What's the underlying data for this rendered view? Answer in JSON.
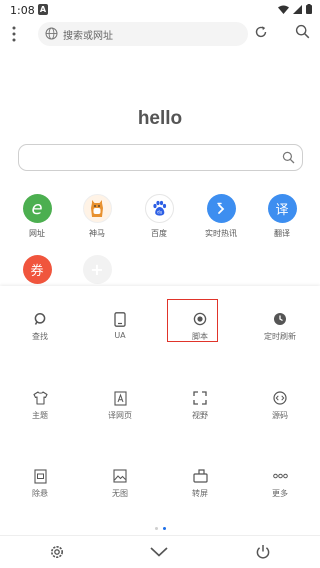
{
  "status_bar": {
    "time": "1:08",
    "indicator": "A"
  },
  "toolbar": {
    "address_placeholder": "搜索或网址"
  },
  "home": {
    "title": "hello"
  },
  "shortcuts": [
    {
      "label": "网址",
      "glyph": "e",
      "color": "#4caf50",
      "icon": "browser-e-icon"
    },
    {
      "label": "神马",
      "glyph": "",
      "color": "#fff3e6",
      "icon": "alpaca-icon"
    },
    {
      "label": "百度",
      "glyph": "",
      "color": "#ffffff",
      "icon": "baidu-paw-icon"
    },
    {
      "label": "实时热讯",
      "glyph": "",
      "color": "#3d8ef0",
      "icon": "hot-news-icon"
    },
    {
      "label": "翻译",
      "glyph": "译",
      "color": "#3d8ef0",
      "icon": "translate-icon"
    },
    {
      "label": "",
      "glyph": "券",
      "color": "#f0553d",
      "icon": "coupon-icon"
    },
    {
      "label": "",
      "glyph": "+",
      "color": "#f2f2f2",
      "icon": "add-icon"
    }
  ],
  "menu": {
    "items": [
      {
        "label": "查找",
        "icon": "find-icon"
      },
      {
        "label": "UA",
        "icon": "ua-icon"
      },
      {
        "label": "脚本",
        "icon": "script-icon"
      },
      {
        "label": "定时刷新",
        "icon": "timer-refresh-icon"
      },
      {
        "label": "主题",
        "icon": "theme-icon"
      },
      {
        "label": "译网页",
        "icon": "translate-page-icon"
      },
      {
        "label": "视野",
        "icon": "view-icon"
      },
      {
        "label": "源码",
        "icon": "source-code-icon"
      },
      {
        "label": "除悬",
        "icon": "remove-float-icon"
      },
      {
        "label": "无图",
        "icon": "no-image-icon"
      },
      {
        "label": "转屏",
        "icon": "rotate-screen-icon"
      },
      {
        "label": "更多",
        "icon": "more-icon"
      }
    ],
    "highlighted": "脚本",
    "highlight_color": "#e0342a"
  },
  "pagination": {
    "pages": 2,
    "current": 2,
    "active_color": "#1e6fe8"
  },
  "bottom_bar": {
    "icons": [
      "settings-icon",
      "collapse-icon",
      "power-icon"
    ]
  }
}
